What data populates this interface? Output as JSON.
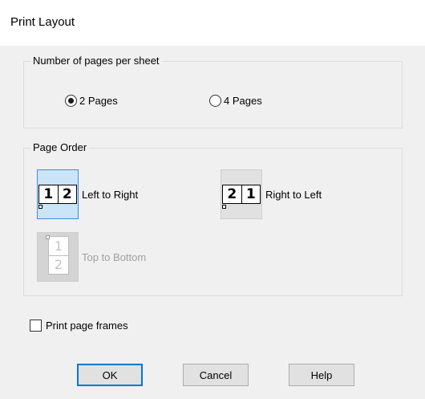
{
  "dialog": {
    "title": "Print Layout"
  },
  "pages_per_sheet": {
    "label": "Number of pages per sheet",
    "options": [
      {
        "label": "2 Pages",
        "checked": true
      },
      {
        "label": "4 Pages",
        "checked": false
      }
    ]
  },
  "page_order": {
    "label": "Page Order",
    "options": [
      {
        "label": "Left to Right",
        "icon": "left-to-right-icon",
        "digits": [
          "1",
          "2"
        ],
        "selected": true,
        "enabled": true
      },
      {
        "label": "Right to Left",
        "icon": "right-to-left-icon",
        "digits": [
          "2",
          "1"
        ],
        "selected": false,
        "enabled": true
      },
      {
        "label": "Top to Bottom",
        "icon": "top-to-bottom-icon",
        "digits": [
          "1",
          "2"
        ],
        "selected": false,
        "enabled": false
      }
    ]
  },
  "print_page_frames": {
    "label": "Print page frames",
    "checked": false
  },
  "buttons": {
    "ok": "OK",
    "cancel": "Cancel",
    "help": "Help"
  }
}
